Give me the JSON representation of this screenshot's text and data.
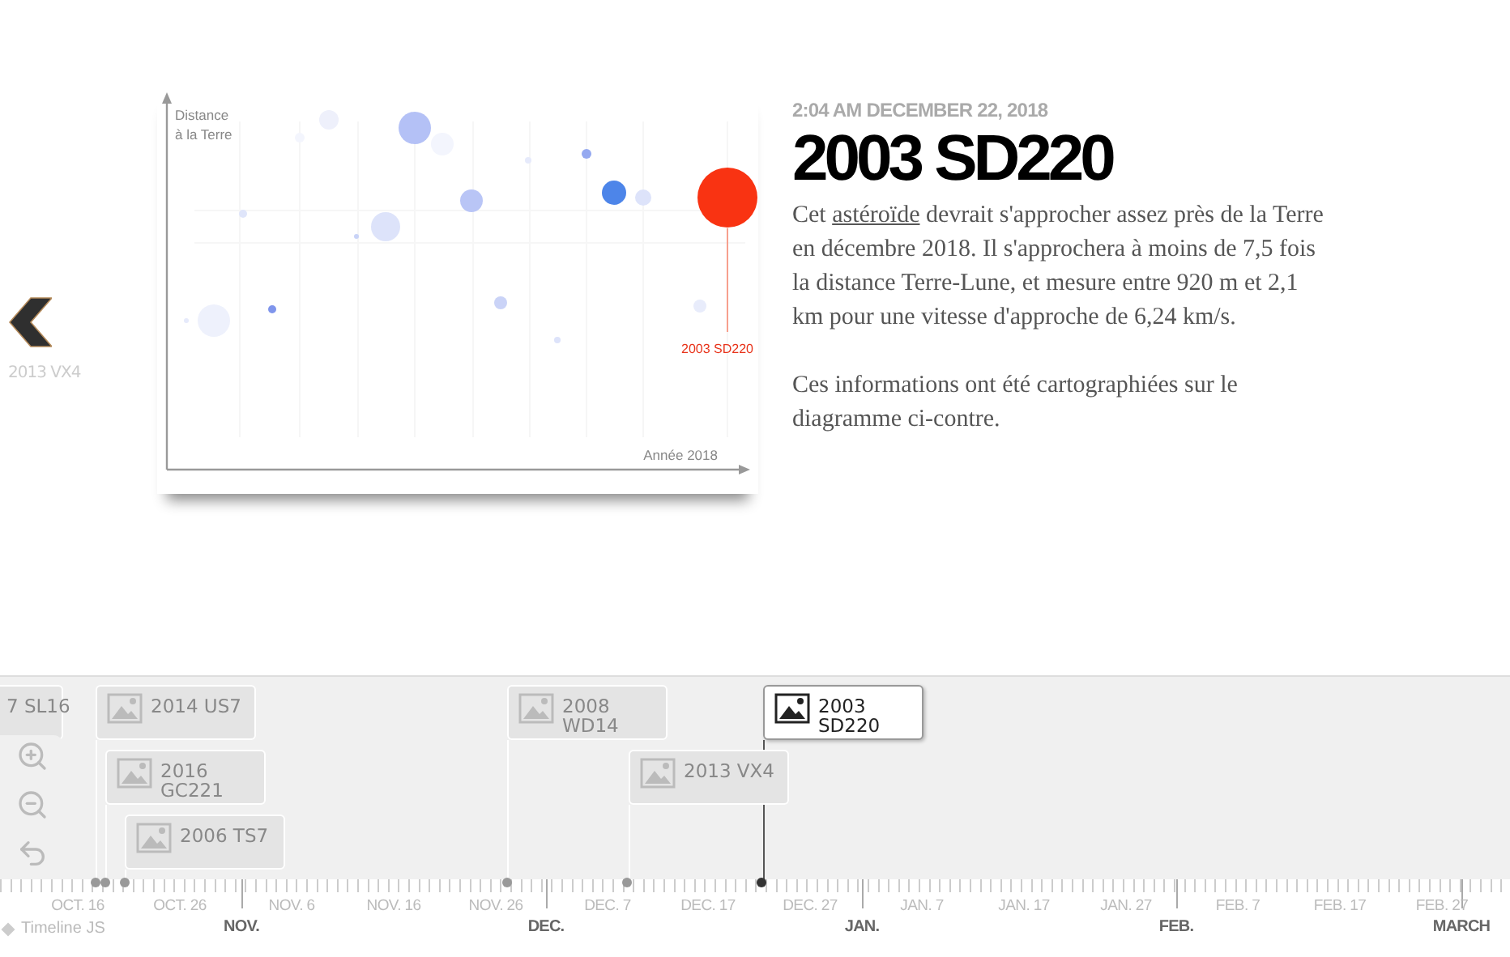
{
  "navigation": {
    "previous": {
      "label": "2013 VX4"
    }
  },
  "slide": {
    "chart": {
      "ylabel": [
        "Distance",
        "à la Terre"
      ],
      "xlabel": "Année 2018",
      "highlight": "2003 SD220"
    },
    "date": "2:04 AM DECEMBER 22, 2018",
    "title": "2003 SD220",
    "paragraphs": [
      {
        "before": "Cet ",
        "link": "astéroïde",
        "after": " devrait s'approcher assez près de la Terre en décembre 2018. Il s'approchera à moins de 7,5 fois la distance Terre-Lune, et mesure entre 920 m et 2,1 km pour une vitesse d'approche de 6,24 km/s."
      },
      {
        "before": "Ces informations ont été cartographiées sur le diagramme ci-contre."
      }
    ]
  },
  "timeline": {
    "events": [
      {
        "label": "7 SL16",
        "kind": "partial",
        "selected": false
      },
      {
        "label": "2014 US7",
        "kind": "event",
        "selected": false
      },
      {
        "label": "2016 GC221",
        "kind": "event",
        "selected": false
      },
      {
        "label": "2006 TS7",
        "kind": "event",
        "selected": false
      },
      {
        "label": "2008 WD14",
        "kind": "event",
        "selected": false
      },
      {
        "label": "2013 VX4",
        "kind": "event",
        "selected": false
      },
      {
        "label": "2003 SD220",
        "kind": "event",
        "selected": true
      }
    ],
    "ticks": [
      "OCT. 16",
      "OCT. 26",
      "NOV. 6",
      "NOV. 16",
      "NOV. 26",
      "DEC. 7",
      "DEC. 17",
      "DEC. 27",
      "JAN. 7",
      "JAN. 17",
      "JAN. 27",
      "FEB. 7",
      "FEB. 17",
      "FEB. 27"
    ],
    "months": [
      "NOV.",
      "DEC.",
      "JAN.",
      "FEB.",
      "MARCH"
    ],
    "credit": "Timeline JS"
  }
}
